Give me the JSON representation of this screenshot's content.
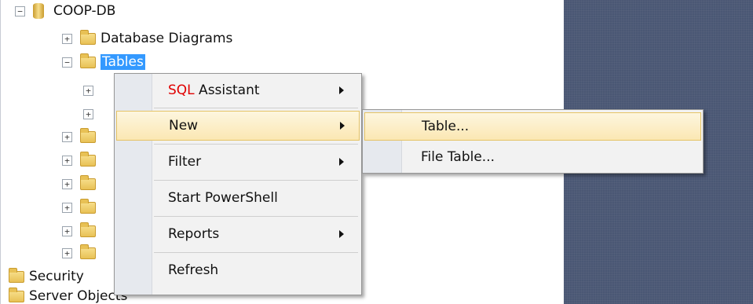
{
  "tree": {
    "database": "COOP-DB",
    "diagrams": "Database Diagrams",
    "tables": "Tables",
    "security": "Security",
    "server_objects": "Server Objects"
  },
  "context_menu": {
    "sql_prefix": "SQL",
    "sql_assistant": " Assistant",
    "new": "New",
    "filter": "Filter",
    "start_powershell": "Start PowerShell",
    "reports": "Reports",
    "refresh": "Refresh"
  },
  "submenu": {
    "table": "Table...",
    "file_table": "File Table..."
  },
  "colors": {
    "selection": "#3399ff",
    "menu_hover": "#fbe7b3",
    "dark_pane": "#4a5774"
  }
}
